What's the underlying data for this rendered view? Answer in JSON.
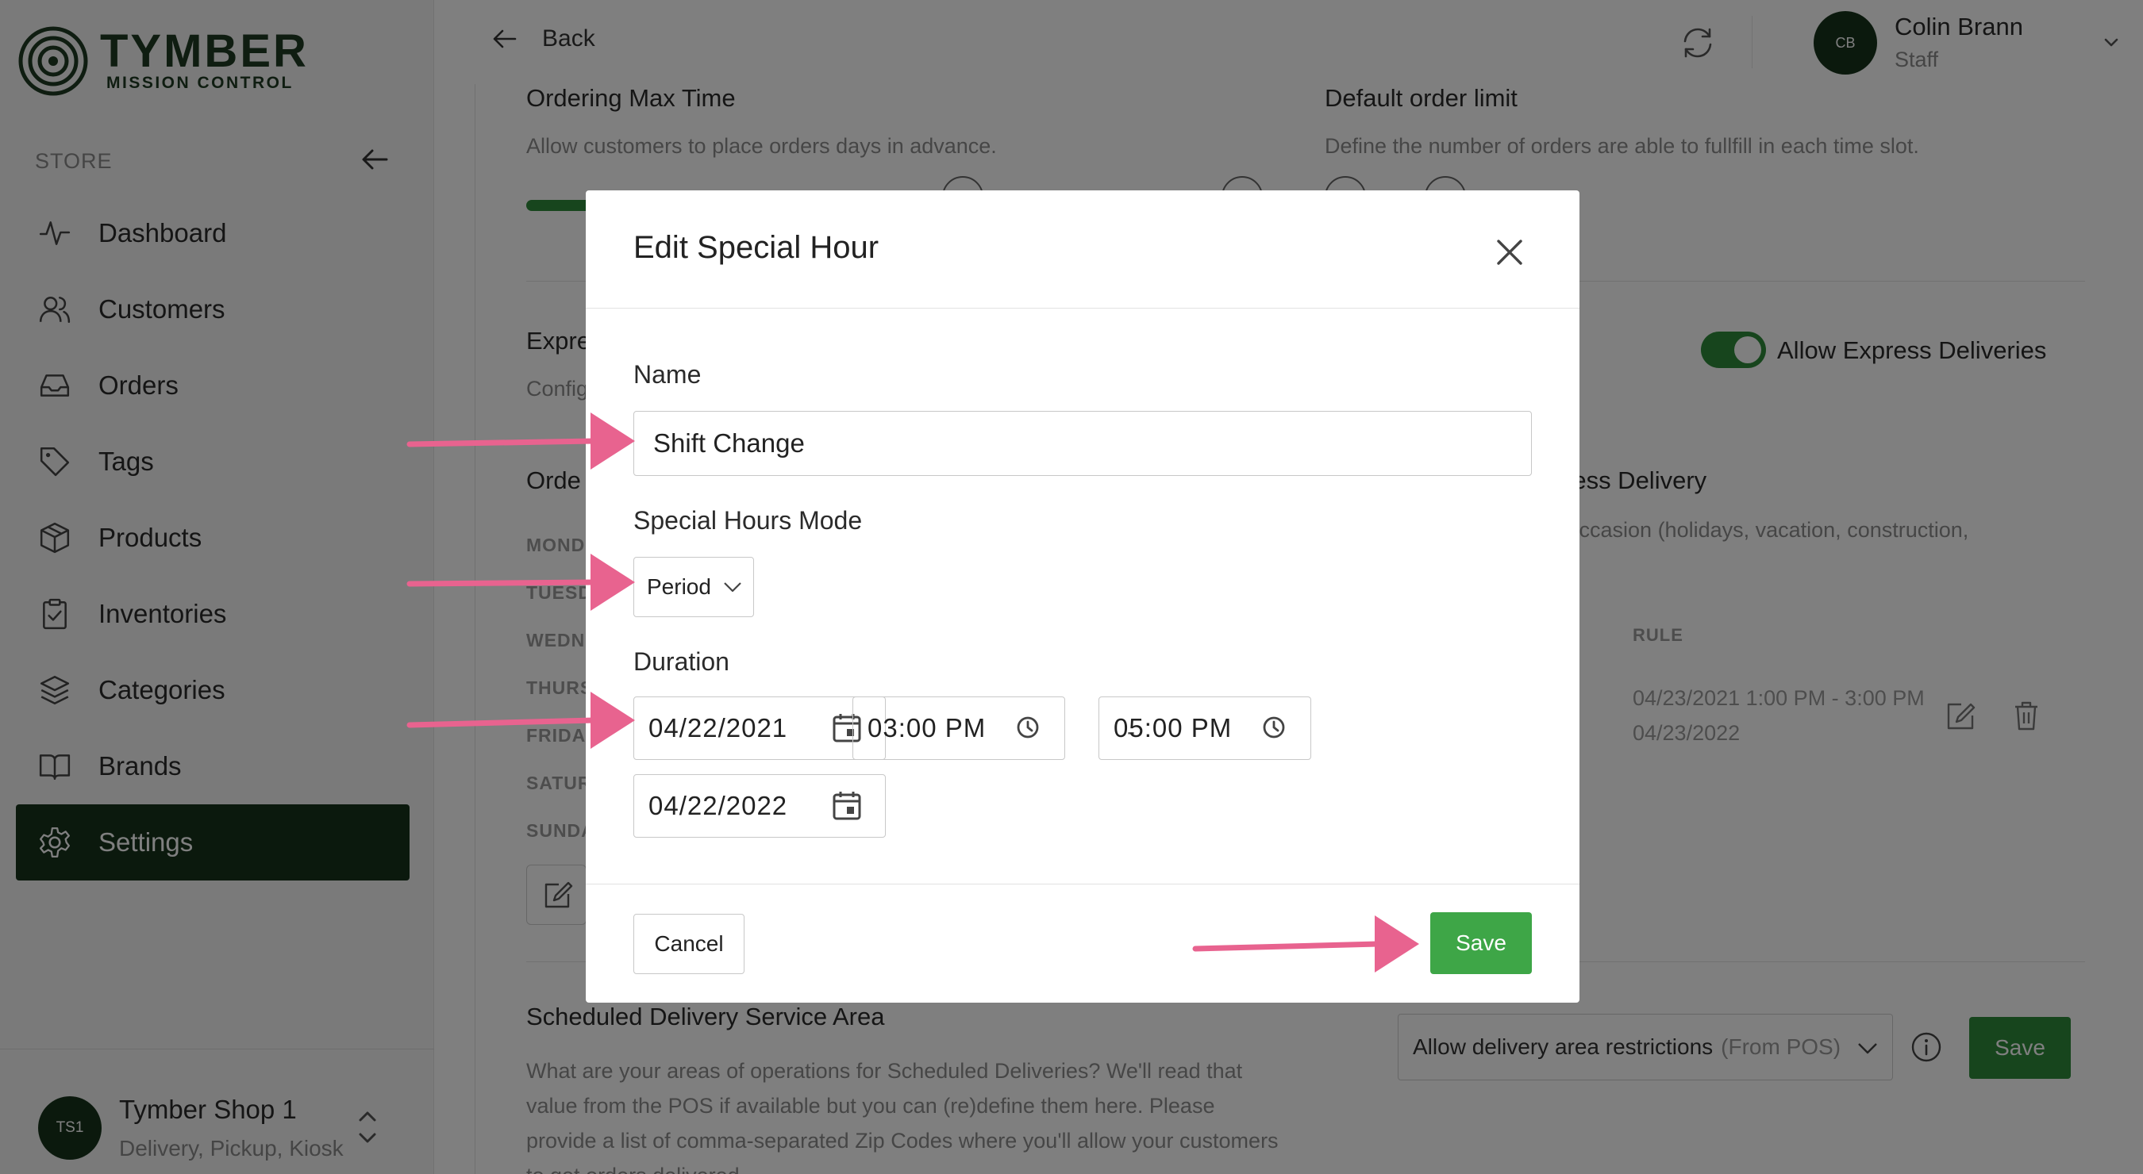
{
  "brand": {
    "name": "TYMBER",
    "subtitle": "MISSION CONTROL"
  },
  "sidebar": {
    "section_label": "STORE",
    "items": [
      {
        "label": "Dashboard",
        "icon": "activity-icon"
      },
      {
        "label": "Customers",
        "icon": "users-icon"
      },
      {
        "label": "Orders",
        "icon": "inbox-icon"
      },
      {
        "label": "Tags",
        "icon": "tag-icon"
      },
      {
        "label": "Products",
        "icon": "box-icon"
      },
      {
        "label": "Inventories",
        "icon": "clipboard-icon"
      },
      {
        "label": "Categories",
        "icon": "layers-icon"
      },
      {
        "label": "Brands",
        "icon": "book-icon"
      },
      {
        "label": "Settings",
        "icon": "gear-icon",
        "active": true
      }
    ],
    "shop": {
      "avatar": "TS1",
      "name": "Tymber Shop 1",
      "subtitle": "Delivery, Pickup, Kiosk"
    }
  },
  "header": {
    "back_label": "Back",
    "user": {
      "initials": "CB",
      "name": "Colin Brann",
      "role": "Staff"
    }
  },
  "background": {
    "ordering_max_time": {
      "title": "Ordering Max Time",
      "desc": "Allow customers to place orders days in advance."
    },
    "default_order_limit": {
      "title": "Default order limit",
      "desc": "Define the number of orders are able to fullfill in each time slot."
    },
    "express_title_partial": "Expre",
    "express_desc_partial": "Config",
    "allow_express_label": "Allow Express Deliveries",
    "order_title_partial": "Orde",
    "days": [
      "MOND",
      "TUESD",
      "WEDN",
      "THURS",
      "FRIDA",
      "SATUR",
      "SUNDA"
    ],
    "special_title_partial": "ress Delivery",
    "special_desc_partial": "l occasion (holidays, vacation, construction,",
    "rule_header": "RULE",
    "rule_text": "04/23/2021 1:00 PM - 3:00 PM 04/23/2022",
    "scheduled": {
      "title": "Scheduled Delivery Service Area",
      "desc": "What are your areas of operations for Scheduled Deliveries? We'll read that value from the POS if available but you can (re)define them here. Please provide a list of comma-separated Zip Codes where you'll allow your customers to get orders delivered.",
      "select_value": "Allow delivery area restrictions",
      "select_muted": "(From POS)",
      "save_label": "Save"
    }
  },
  "modal": {
    "title": "Edit Special Hour",
    "name_label": "Name",
    "name_value": "Shift Change",
    "mode_label": "Special Hours Mode",
    "mode_value": "Period",
    "duration_label": "Duration",
    "start_date": "04/22/2021",
    "start_time": "03:00 PM",
    "separator": "-",
    "end_time": "05:00 PM",
    "end_date": "04/22/2022",
    "cancel_label": "Cancel",
    "save_label": "Save"
  },
  "colors": {
    "brand_dark": "#17331b",
    "accent_green": "#3ea647",
    "annotation_arrow": "#e8638f"
  }
}
